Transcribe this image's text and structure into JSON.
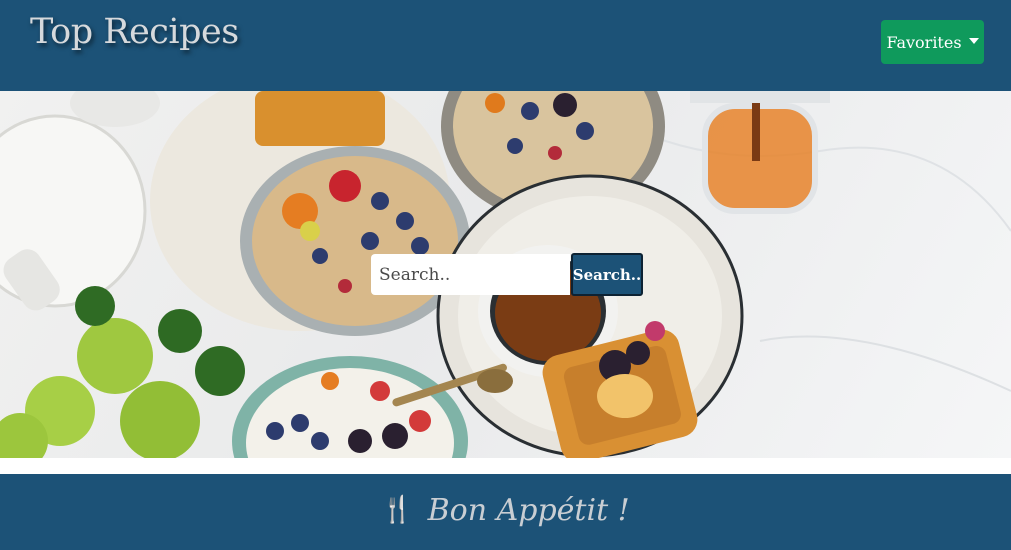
{
  "header": {
    "brand": "Top Recipes",
    "favorites_label": "Favorites",
    "favorites_icon": "caret-down-icon"
  },
  "search": {
    "placeholder": "Search..",
    "button_label": "Search.."
  },
  "footer": {
    "icon": "utensils-icon",
    "icon_glyph": "🍴",
    "text": "Bon Appétit !"
  },
  "colors": {
    "navbar": "#1c5277",
    "favorites_button": "#0f9a5c",
    "search_button": "#1c5277",
    "footer": "#1c5277"
  }
}
